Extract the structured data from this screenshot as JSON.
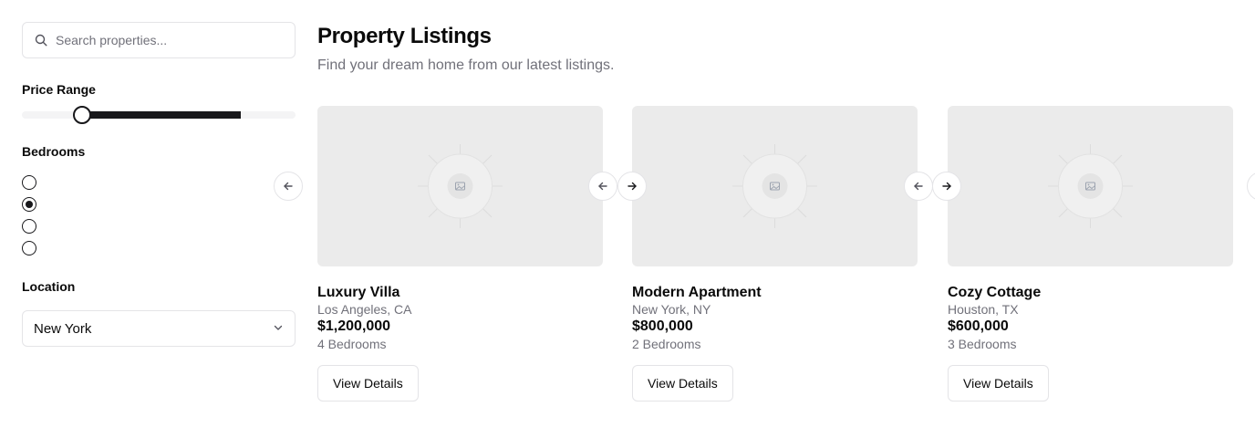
{
  "search": {
    "placeholder": "Search properties..."
  },
  "filters": {
    "price_label": "Price Range",
    "price_range_fraction": [
      0.22,
      0.8
    ],
    "bedrooms_label": "Bedrooms",
    "bedroom_options_count": 4,
    "bedroom_selected_index": 1,
    "location_label": "Location",
    "location_value": "New York"
  },
  "header": {
    "title": "Property Listings",
    "subtitle": "Find your dream home from our latest listings."
  },
  "listings": [
    {
      "title": "Luxury Villa",
      "location": "Los Angeles, CA",
      "price": "$1,200,000",
      "bedrooms": "4 Bedrooms",
      "button": "View Details"
    },
    {
      "title": "Modern Apartment",
      "location": "New York, NY",
      "price": "$800,000",
      "bedrooms": "2 Bedrooms",
      "button": "View Details"
    },
    {
      "title": "Cozy Cottage",
      "location": "Houston, TX",
      "price": "$600,000",
      "bedrooms": "3 Bedrooms",
      "button": "View Details"
    }
  ],
  "icons": {
    "search": "search-icon",
    "chevron": "chevron-down-icon",
    "previous": "arrow-left-icon",
    "next": "arrow-right-icon",
    "placeholder": "image-placeholder-icon"
  },
  "colors": {
    "accent": "#18181b",
    "muted_text": "#71717a",
    "border": "#e4e4e7",
    "image_bg": "#ebebeb"
  }
}
